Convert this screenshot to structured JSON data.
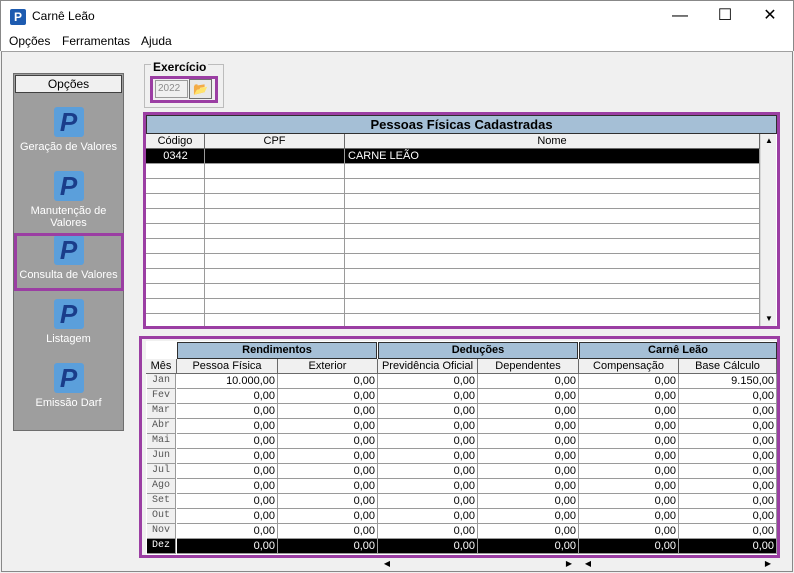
{
  "window": {
    "title": "Carnê Leão",
    "minimize": "—",
    "maximize": "☐",
    "close": "✕"
  },
  "menu": [
    "Opções",
    "Ferramentas",
    "Ajuda"
  ],
  "sidebar": {
    "header": "Opções",
    "items": [
      {
        "label": "Geração de Valores",
        "icon": "p-app-icon"
      },
      {
        "label": "Manutenção de Valores",
        "icon": "p-app-icon"
      },
      {
        "label": "Consulta de Valores",
        "icon": "p-app-icon"
      },
      {
        "label": "Listagem",
        "icon": "p-app-icon"
      },
      {
        "label": "Emissão Darf",
        "icon": "p-app-icon"
      }
    ]
  },
  "exercicio": {
    "label": "Exercício",
    "value": "2022",
    "folder_icon": "open-folder-icon"
  },
  "people_grid": {
    "caption": "Pessoas Físicas Cadastradas",
    "columns": [
      "Código",
      "CPF",
      "Nome"
    ],
    "rows": [
      {
        "codigo": "0342",
        "cpf": "",
        "nome": "CARNE LEÃO"
      }
    ]
  },
  "values_grid": {
    "groups": [
      "Rendimentos",
      "Deduções",
      "Carnê Leão"
    ],
    "columns": [
      "Mês",
      "Pessoa Física",
      "Exterior",
      "Previdência Oficial",
      "Dependentes",
      "Compensação",
      "Base Cálculo"
    ],
    "rows": [
      {
        "mes": "Jan",
        "v": [
          "10.000,00",
          "0,00",
          "0,00",
          "0,00",
          "0,00",
          "9.150,00"
        ]
      },
      {
        "mes": "Fev",
        "v": [
          "0,00",
          "0,00",
          "0,00",
          "0,00",
          "0,00",
          "0,00"
        ]
      },
      {
        "mes": "Mar",
        "v": [
          "0,00",
          "0,00",
          "0,00",
          "0,00",
          "0,00",
          "0,00"
        ]
      },
      {
        "mes": "Abr",
        "v": [
          "0,00",
          "0,00",
          "0,00",
          "0,00",
          "0,00",
          "0,00"
        ]
      },
      {
        "mes": "Mai",
        "v": [
          "0,00",
          "0,00",
          "0,00",
          "0,00",
          "0,00",
          "0,00"
        ]
      },
      {
        "mes": "Jun",
        "v": [
          "0,00",
          "0,00",
          "0,00",
          "0,00",
          "0,00",
          "0,00"
        ]
      },
      {
        "mes": "Jul",
        "v": [
          "0,00",
          "0,00",
          "0,00",
          "0,00",
          "0,00",
          "0,00"
        ]
      },
      {
        "mes": "Ago",
        "v": [
          "0,00",
          "0,00",
          "0,00",
          "0,00",
          "0,00",
          "0,00"
        ]
      },
      {
        "mes": "Set",
        "v": [
          "0,00",
          "0,00",
          "0,00",
          "0,00",
          "0,00",
          "0,00"
        ]
      },
      {
        "mes": "Out",
        "v": [
          "0,00",
          "0,00",
          "0,00",
          "0,00",
          "0,00",
          "0,00"
        ]
      },
      {
        "mes": "Nov",
        "v": [
          "0,00",
          "0,00",
          "0,00",
          "0,00",
          "0,00",
          "0,00"
        ]
      },
      {
        "mes": "Dez",
        "v": [
          "0,00",
          "0,00",
          "0,00",
          "0,00",
          "0,00",
          "0,00"
        ]
      }
    ]
  },
  "colors": {
    "highlight": "#9b3ea3",
    "caption_bg": "#a5bfd6",
    "sidebar_bg": "#9e9e9e",
    "icon_blue": "#5b9fdb"
  }
}
